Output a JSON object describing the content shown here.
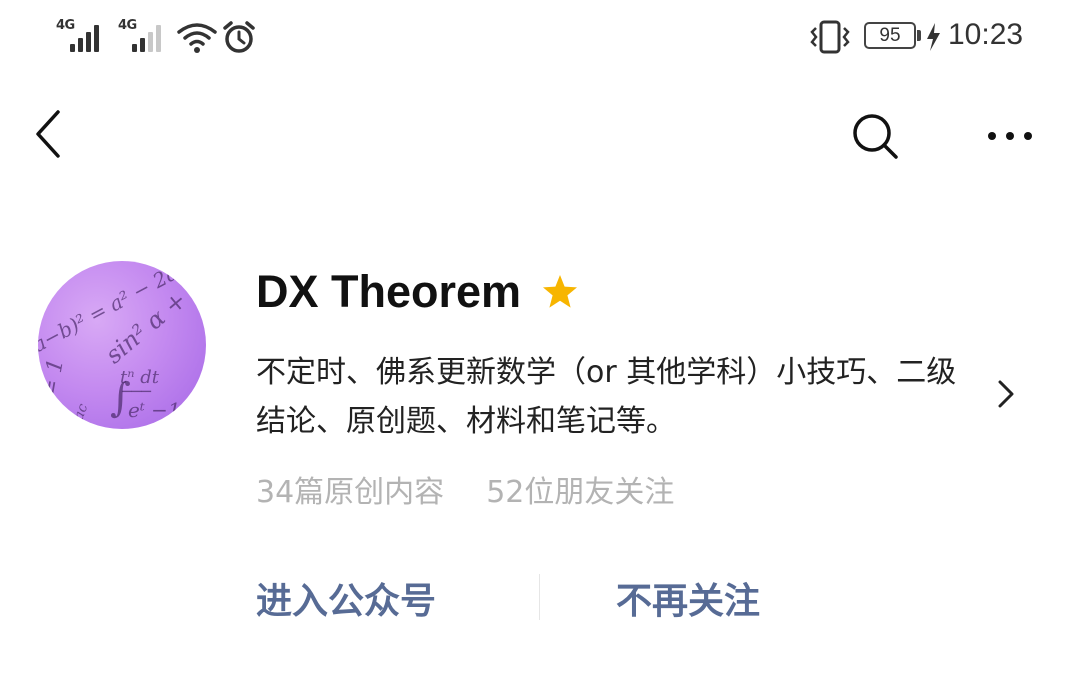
{
  "status_bar": {
    "network_1": "4G",
    "network_2": "4G",
    "battery": "95",
    "time": "10:23",
    "icons": [
      "signal-icon",
      "signal-icon",
      "wifi-icon",
      "alarm-icon",
      "vibrate-icon",
      "battery-icon",
      "charging-icon"
    ]
  },
  "nav": {
    "back_icon": "chevron-left-icon",
    "search_icon": "search-icon",
    "more_icon": "more-dots-icon"
  },
  "profile": {
    "name": "DX Theorem",
    "badge_color": "#f7b500",
    "description": "不定时、佛系更新数学（or 其他学科）小技巧、二级结论、原创题、材料和笔记等。",
    "stats": {
      "original_posts": "34篇原创内容",
      "followers": "52位朋友关注"
    }
  },
  "actions": {
    "enter": "进入公众号",
    "unfollow": "不再关注",
    "link_color": "#576b95"
  }
}
